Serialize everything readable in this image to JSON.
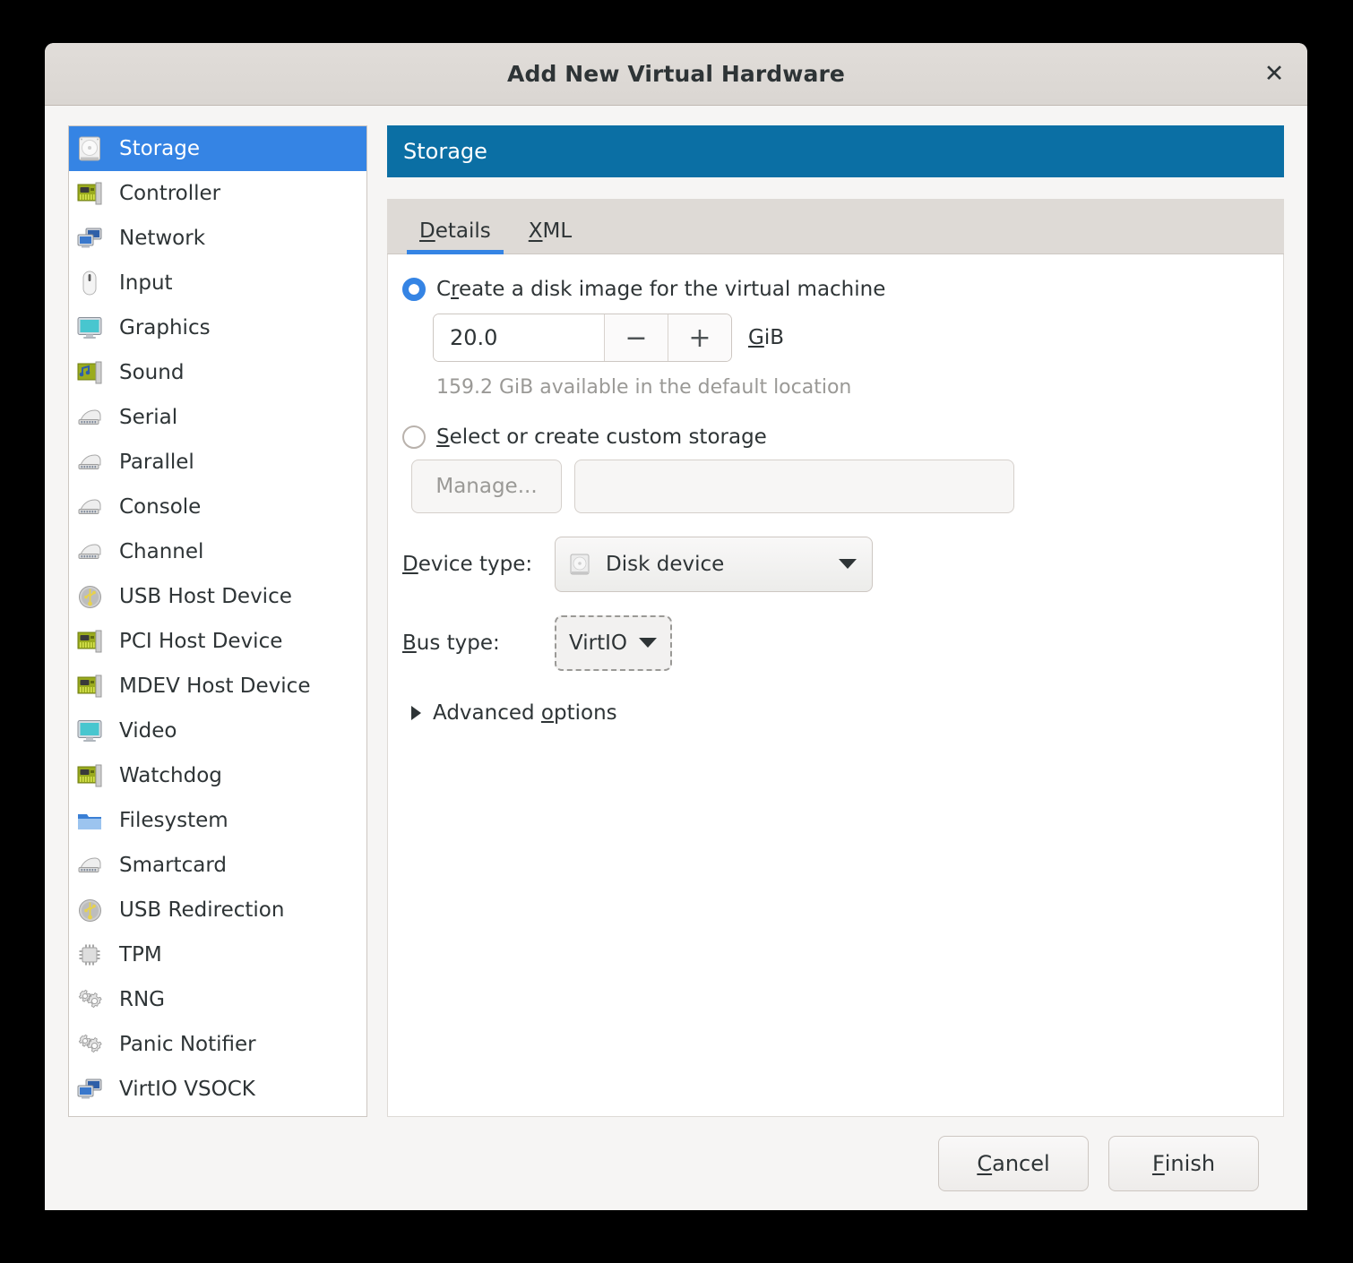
{
  "window": {
    "title": "Add New Virtual Hardware",
    "close_label": "✕"
  },
  "colors": {
    "accent_selection": "#3584e4",
    "panel_header_bg": "#0b6fa4",
    "dialog_bg": "#f6f5f4",
    "titlebar_bg": "#dad6d2",
    "text": "#2e3436",
    "muted_text": "#9a9996"
  },
  "sidebar": {
    "items": [
      {
        "label": "Storage",
        "icon": "harddisk-icon",
        "selected": true
      },
      {
        "label": "Controller",
        "icon": "pci-card-icon",
        "selected": false
      },
      {
        "label": "Network",
        "icon": "network-icon",
        "selected": false
      },
      {
        "label": "Input",
        "icon": "mouse-icon",
        "selected": false
      },
      {
        "label": "Graphics",
        "icon": "display-icon",
        "selected": false
      },
      {
        "label": "Sound",
        "icon": "soundcard-icon",
        "selected": false
      },
      {
        "label": "Serial",
        "icon": "serial-port-icon",
        "selected": false
      },
      {
        "label": "Parallel",
        "icon": "serial-port-icon",
        "selected": false
      },
      {
        "label": "Console",
        "icon": "serial-port-icon",
        "selected": false
      },
      {
        "label": "Channel",
        "icon": "serial-port-icon",
        "selected": false
      },
      {
        "label": "USB Host Device",
        "icon": "usb-icon",
        "selected": false
      },
      {
        "label": "PCI Host Device",
        "icon": "pci-card-icon",
        "selected": false
      },
      {
        "label": "MDEV Host Device",
        "icon": "pci-card-icon",
        "selected": false
      },
      {
        "label": "Video",
        "icon": "display-icon",
        "selected": false
      },
      {
        "label": "Watchdog",
        "icon": "pci-card-icon",
        "selected": false
      },
      {
        "label": "Filesystem",
        "icon": "folder-icon",
        "selected": false
      },
      {
        "label": "Smartcard",
        "icon": "serial-port-icon",
        "selected": false
      },
      {
        "label": "USB Redirection",
        "icon": "usb-icon",
        "selected": false
      },
      {
        "label": "TPM",
        "icon": "chip-icon",
        "selected": false
      },
      {
        "label": "RNG",
        "icon": "gears-icon",
        "selected": false
      },
      {
        "label": "Panic Notifier",
        "icon": "gears-icon",
        "selected": false
      },
      {
        "label": "VirtIO VSOCK",
        "icon": "network-icon",
        "selected": false
      }
    ]
  },
  "panel": {
    "header_title": "Storage",
    "tabs": [
      {
        "label_pre": "",
        "accel": "D",
        "label_post": "etails",
        "active": true
      },
      {
        "label_pre": "",
        "accel": "X",
        "label_post": "ML",
        "active": false
      }
    ]
  },
  "form": {
    "create_radio": {
      "pre": "C",
      "accel": "r",
      "post": "eate a disk image for the virtual machine",
      "checked": true
    },
    "size_value": "20.0",
    "spin_minus": "−",
    "spin_plus": "+",
    "unit_pre": "",
    "unit_accel": "G",
    "unit_post": "iB",
    "available_hint": "159.2 GiB available in the default location",
    "custom_radio": {
      "pre": "",
      "accel": "S",
      "post": "elect or create custom storage",
      "checked": false
    },
    "manage_button": "Manage...",
    "path_value": "",
    "path_placeholder": "",
    "device_type": {
      "label_pre": "",
      "label_accel": "D",
      "label_post": "evice type:",
      "value": "Disk device",
      "icon": "harddisk-icon"
    },
    "bus_type": {
      "label_pre": "",
      "label_accel": "B",
      "label_post": "us type:",
      "value": "VirtIO"
    },
    "advanced": {
      "pre": "Advanced ",
      "accel": "o",
      "post": "ptions",
      "expanded": false,
      "triangle": "collapsed-triangle-icon"
    }
  },
  "footer": {
    "cancel": {
      "pre": "",
      "accel": "C",
      "post": "ancel"
    },
    "finish": {
      "pre": "",
      "accel": "F",
      "post": "inish"
    }
  }
}
